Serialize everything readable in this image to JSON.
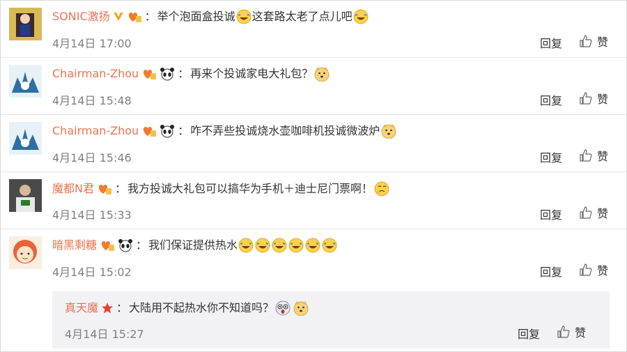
{
  "comments": [
    {
      "username": "SONIC激扬",
      "text": "举个泡面盒投诚",
      "text_b": "这套路太老了点儿吧",
      "time": "4月14日 17:00",
      "reply": "回复",
      "like": "赞"
    },
    {
      "username": "Chairman-Zhou",
      "text": "再来个投诚家电大礼包？",
      "time": "4月14日 15:48",
      "reply": "回复",
      "like": "赞"
    },
    {
      "username": "Chairman-Zhou",
      "text": "咋不弄些投诚烧水壶咖啡机投诚微波炉",
      "time": "4月14日 15:46",
      "reply": "回复",
      "like": "赞"
    },
    {
      "username": "魔都N君",
      "text": "我方投诚大礼包可以搞华为手机＋迪士尼门票啊！",
      "time": "4月14日 15:33",
      "reply": "回复",
      "like": "赞"
    },
    {
      "username": "暗黑剩糖",
      "text": "我们保证提供热水",
      "time": "4月14日 15:02",
      "reply": "回复",
      "like": "赞"
    }
  ],
  "sub_reply": {
    "username": "真天魔",
    "text": "大陆用不起热水你不知道吗？",
    "time": "4月14日 15:27",
    "reply": "回复",
    "like": "赞"
  },
  "colors": {
    "username": "#eb7350",
    "meta": "#808080",
    "sub_bg": "#f2f2f5",
    "emoji": "#fbd24a"
  }
}
